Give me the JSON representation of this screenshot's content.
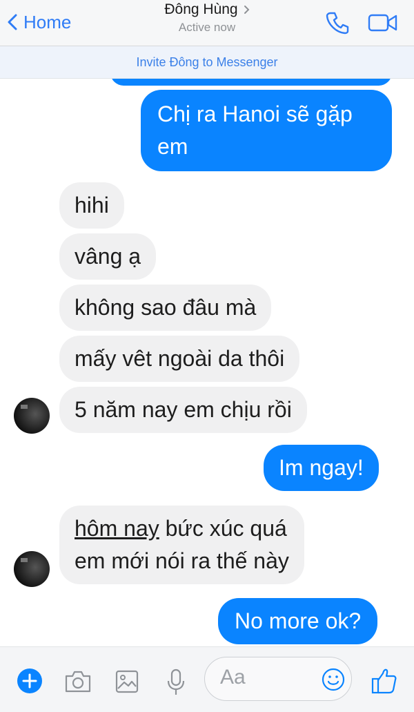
{
  "header": {
    "back_label": "Home",
    "contact_name": "Đông Hùng",
    "status": "Active now"
  },
  "invite": {
    "text": "Invite Đông to Messenger"
  },
  "messages": [
    {
      "side": "out",
      "text": "Chị ra Hanoi sẽ gặp em"
    },
    {
      "side": "in",
      "text": "hihi"
    },
    {
      "side": "in",
      "text": "vâng ạ"
    },
    {
      "side": "in",
      "text": "không sao đâu mà"
    },
    {
      "side": "in",
      "text": "mấy vêt ngoài da thôi"
    },
    {
      "side": "in",
      "text": "5 năm nay em chịu rồi"
    },
    {
      "side": "out",
      "text": "Im ngay!"
    },
    {
      "side": "in",
      "text_underlined": "hôm nay",
      "text_rest": " bức xúc quá",
      "text_line2": "em mới nói ra thế này"
    },
    {
      "side": "out",
      "text": "No more ok?"
    }
  ],
  "composer": {
    "placeholder": "Aa",
    "icons": [
      "plus-icon",
      "camera-icon",
      "image-icon",
      "microphone-icon",
      "emoji-icon",
      "thumbs-up-icon"
    ]
  },
  "colors": {
    "accent": "#0a84ff",
    "incoming_bubble": "#f0f0f1",
    "link": "#2f7cf6"
  }
}
